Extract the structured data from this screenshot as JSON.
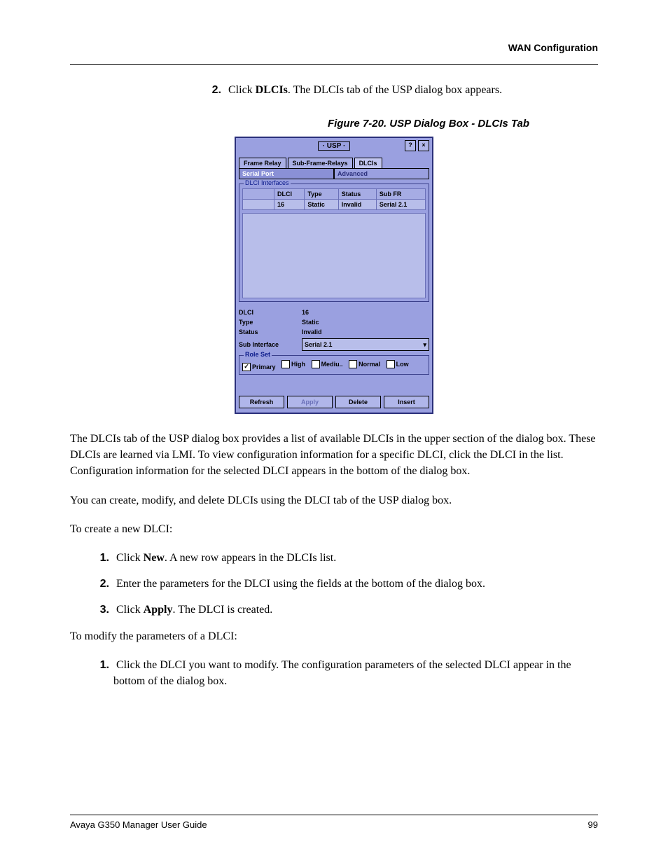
{
  "header": {
    "right": "WAN Configuration"
  },
  "intro": {
    "num": "2.",
    "prefix": "Click ",
    "bold": "DLCIs",
    "suffix": ". The DLCIs tab of the USP dialog box appears."
  },
  "figure_caption": "Figure 7-20.  USP Dialog Box - DLCIs Tab",
  "dialog": {
    "title": "· USP ·",
    "close_symbol": "×",
    "help_symbol": "?",
    "tabs": [
      "Frame Relay",
      "Sub-Frame-Relays",
      "DLCIs"
    ],
    "subtabs": [
      "Serial Port",
      "Advanced"
    ],
    "panel_label": "DLCI Interfaces",
    "columns": [
      "",
      "DLCI",
      "Type",
      "Status",
      "Sub FR"
    ],
    "row": [
      "",
      "16",
      "Static",
      "Invalid",
      "Serial 2.1"
    ],
    "form": {
      "dlci_label": "DLCI",
      "dlci_val": "16",
      "type_label": "Type",
      "type_val": "Static",
      "status_label": "Status",
      "status_val": "Invalid",
      "sub_label": "Sub Interface",
      "sub_val": "Serial 2.1"
    },
    "role_label": "Role Set",
    "roles": [
      "Primary",
      "High",
      "Mediu..",
      "Normal",
      "Low"
    ],
    "roles_checked": [
      true,
      false,
      false,
      false,
      false
    ],
    "buttons": [
      "Refresh",
      "Apply",
      "Delete",
      "Insert"
    ]
  },
  "body": {
    "p1": "The DLCIs tab of the USP dialog box provides a list of available DLCIs in the upper section of the dialog box. These DLCIs are learned via LMI. To view configuration information for a specific DLCI, click the DLCI in the list. Configuration information for the selected DLCI appears in the bottom of the dialog box.",
    "p2": "You can create, modify, and delete DLCIs using the DLCI tab of the USP dialog box.",
    "p3": "To create a new DLCI:",
    "steps1": [
      {
        "n": "1.",
        "pre": "Click ",
        "b": "New",
        "post": ". A new row appears in the DLCIs list."
      },
      {
        "n": "2.",
        "pre": "",
        "b": "",
        "post": "Enter the parameters for the DLCI using the fields at the bottom of the dialog box."
      },
      {
        "n": "3.",
        "pre": "Click ",
        "b": "Apply",
        "post": ". The DLCI is created."
      }
    ],
    "p4": "To modify the parameters of a DLCI:",
    "steps2": [
      {
        "n": "1.",
        "pre": "",
        "b": "",
        "post": "Click the DLCI you want to modify. The configuration parameters of the selected DLCI appear in the bottom of the dialog box."
      }
    ]
  },
  "footer": {
    "left": "Avaya G350 Manager User Guide",
    "right": "99"
  }
}
